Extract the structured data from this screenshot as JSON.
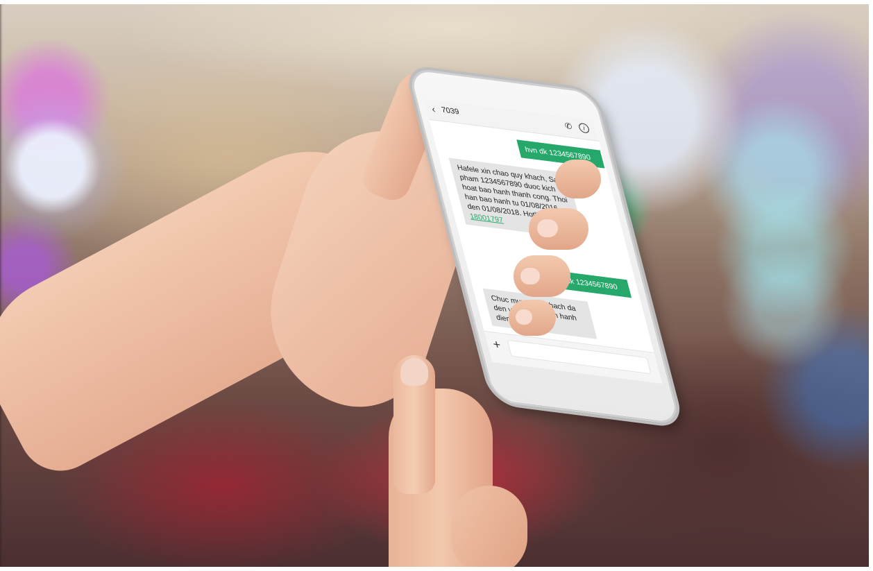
{
  "conversation": {
    "contact_name": "7039",
    "back_glyph": "‹",
    "call_glyph": "✆",
    "info_glyph": "i",
    "icons": [
      "back-icon",
      "call-icon",
      "info-icon",
      "plus-icon"
    ],
    "messages": [
      {
        "direction": "outgoing",
        "text": "hvn dk 1234567890"
      },
      {
        "direction": "incoming",
        "text": "Hafele xin chao quy khach, San pham 1234567890 duoc kich hoat bao hanh thanh cong. Thoi han bao hanh tu 01/08/2016 den 01/08/2018. Hotline: ",
        "link": "18001797"
      },
      {
        "direction": "outgoing",
        "text": "hvn dk 1234567890"
      },
      {
        "direction": "incoming",
        "text": "Chuc mung quy khach da den voi dich vu ban hanh dien tu"
      }
    ],
    "compose": {
      "add_glyph": "+",
      "value": ""
    }
  },
  "colors": {
    "outgoing_bubble": "#27a86b",
    "incoming_bubble": "#e4e4e4",
    "link": "#27a86b"
  }
}
